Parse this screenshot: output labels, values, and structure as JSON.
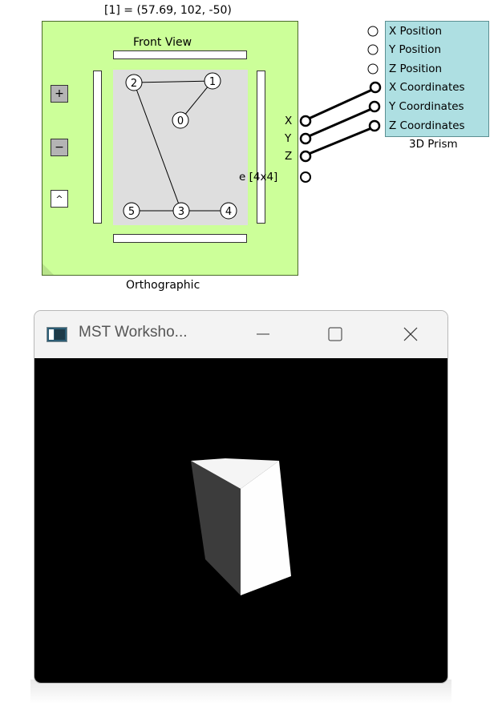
{
  "orthographic": {
    "coordinate_readout": "[1] = (57.69, 102, -50)",
    "view_label": "Front View",
    "block_label": "Orthographic",
    "buttons": {
      "zoom_in": "+",
      "zoom_out": "−",
      "toggle": "^"
    },
    "nodes": [
      "0",
      "1",
      "2",
      "3",
      "4",
      "5"
    ],
    "ports": {
      "x": "X",
      "y": "Y",
      "z": "Z",
      "matrix": "e [4x4]"
    },
    "colors": {
      "block": "#ccff99",
      "canvas": "#dedede"
    }
  },
  "prism": {
    "title": "3D Prism",
    "ports": [
      "X Position",
      "Y Position",
      "Z Position",
      "X Coordinates",
      "Y Coordinates",
      "Z Coordinates"
    ],
    "colors": {
      "block": "#aedfe2"
    }
  },
  "window": {
    "title": "MST Worksho...",
    "icon": "app-window-icon",
    "controls": [
      "minimize-icon",
      "maximize-icon",
      "close-icon"
    ],
    "colors": {
      "titlebar": "#f3f3f3",
      "viewport": "#000000"
    }
  }
}
